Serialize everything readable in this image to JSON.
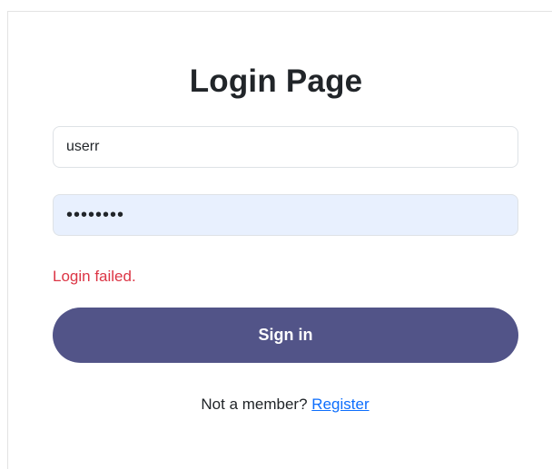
{
  "page": {
    "title": "Login Page"
  },
  "form": {
    "username_value": "userr",
    "password_value": "••••••••",
    "error_text": "Login failed.",
    "signin_label": "Sign in"
  },
  "footer": {
    "prompt_text": "Not a member?",
    "register_link": "Register"
  },
  "colors": {
    "button": "#525488",
    "error": "#dc3545",
    "link": "#0d6efd",
    "autofill": "#e8f0fe"
  }
}
